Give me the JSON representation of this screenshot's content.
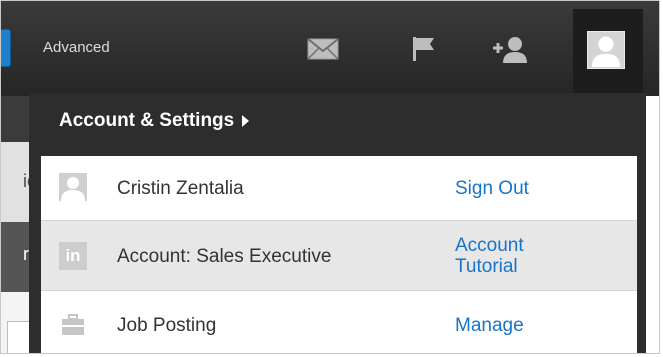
{
  "nav": {
    "advanced_label": "Advanced",
    "icons": {
      "messages": "envelope-icon",
      "notifications": "flag-icon",
      "add_connections": "add-connection-icon",
      "profile": "profile-avatar-icon"
    }
  },
  "page": {
    "stub_a": "ic",
    "stub_b": "ri"
  },
  "dropdown": {
    "header": "Account & Settings",
    "items": [
      {
        "label": "Cristin Zentalia",
        "action": "Sign Out",
        "icon": "user-avatar-icon"
      },
      {
        "label": "Account: Sales Executive",
        "action_line1": "Account",
        "action_line2": "Tutorial",
        "icon": "linkedin-icon",
        "icon_text": "in"
      },
      {
        "label": "Job Posting",
        "action": "Manage",
        "icon": "briefcase-icon"
      }
    ]
  },
  "colors": {
    "nav_bg": "#2f2f2f",
    "dropdown_bg": "#2d2d2d",
    "link": "#1774c8",
    "highlight_row": "#e7e7e7"
  }
}
